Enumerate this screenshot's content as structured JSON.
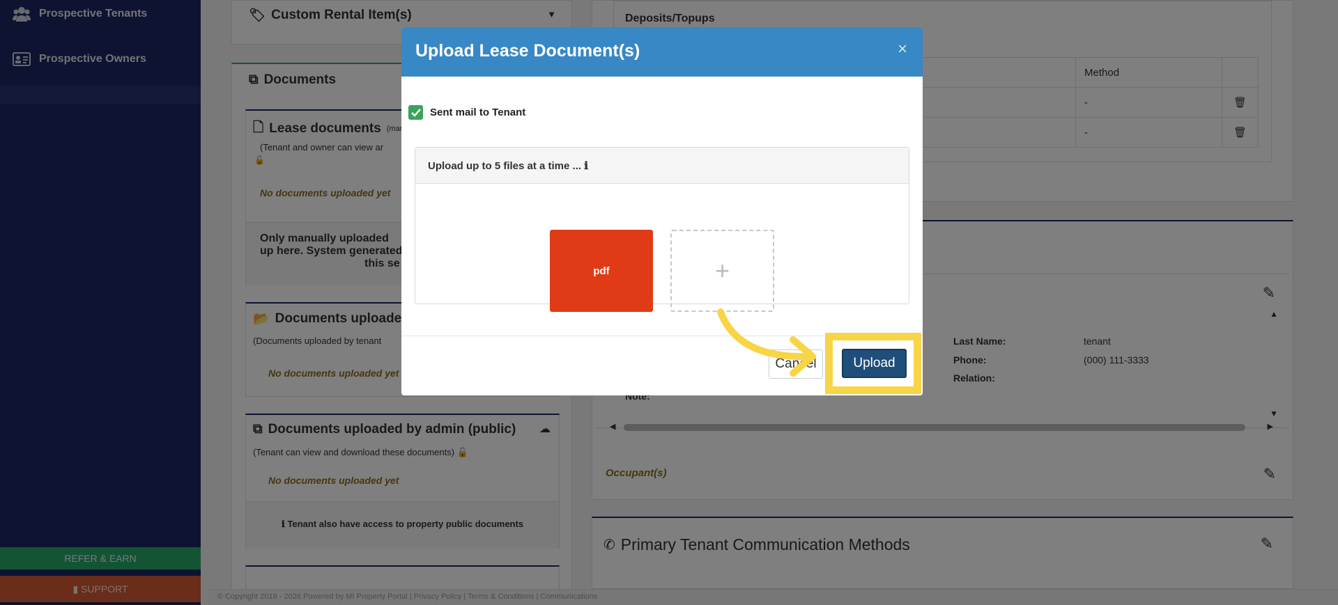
{
  "sidebar": {
    "items": [
      {
        "label": "Prospective Tenants",
        "icon": "users-icon"
      },
      {
        "label": "Prospective Owners",
        "icon": "id-card-icon"
      }
    ],
    "refer": "REFER & EARN",
    "support": "SUPPORT"
  },
  "left": {
    "custom_rental": "Custom Rental Item(s)",
    "documents_title": "Documents",
    "lease_docs": {
      "title": "Lease documents",
      "title_suffix": "(mar",
      "note": "(Tenant and owner can view ar",
      "empty": "No documents uploaded yet",
      "info_lines": [
        "Only manually uploaded",
        "up here. System generated",
        "this se"
      ]
    },
    "docs_uploaded": {
      "title": "Documents uploaded",
      "note": "(Documents uploaded by tenant",
      "empty": "No documents uploaded yet"
    },
    "admin_public": {
      "title": "Documents uploaded by admin (public)",
      "note": "(Tenant can view and download these documents)",
      "empty": "No documents uploaded yet",
      "info": "Tenant also have access to property public documents"
    }
  },
  "right": {
    "deposits_title": "Deposits/Topups",
    "method_header": "Method",
    "rows": [
      "-",
      "-"
    ],
    "contact": {
      "last_name_label": "Last Name:",
      "last_name_value": "tenant",
      "phone_label": "Phone:",
      "phone_value": "(000) 111-3333",
      "relation_label": "Relation:",
      "note_label": "Note:"
    },
    "occupants": "Occupant(s)",
    "comm_title": "Primary Tenant Communication Methods"
  },
  "footer": "© Copyright 2018 - 2026 Powered by MI Property Portal | Privacy Policy | Terms & Conditions | Communications",
  "modal": {
    "title": "Upload Lease Document(s)",
    "close": "×",
    "checkbox_label": "Sent mail to Tenant",
    "checkbox_checked": true,
    "upload_hint": "Upload up to 5 files at a time ...",
    "file_tile": "pdf",
    "add_tile": "+",
    "cancel": "Cancel",
    "upload": "Upload"
  },
  "colors": {
    "sidebar": "#1a2660",
    "modal_header": "#3788c4",
    "highlight": "#f8d547",
    "pdf_tile": "#e03b16",
    "upload_button": "#1f4e7a"
  }
}
